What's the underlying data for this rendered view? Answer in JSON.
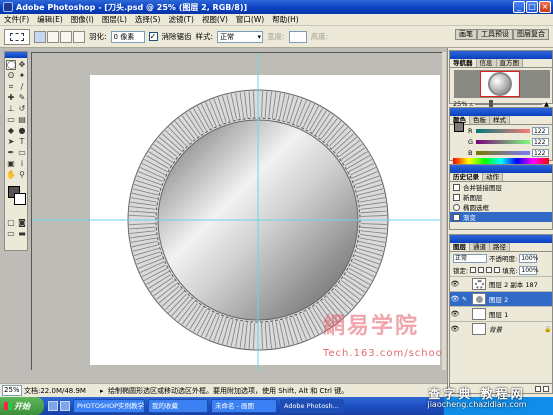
{
  "window": {
    "title": "Adobe Photoshop - [刀头.psd @ 25% (图层 2, RGB/8)]",
    "controls": {
      "minimize": "_",
      "maximize": "□",
      "close": "×"
    }
  },
  "menu": [
    "文件(F)",
    "编辑(E)",
    "图像(I)",
    "图层(L)",
    "选择(S)",
    "滤镜(T)",
    "视图(V)",
    "窗口(W)",
    "帮助(H)"
  ],
  "options": {
    "feather_label": "羽化:",
    "feather_value": "0 像素",
    "antialias_label": "消除锯齿",
    "antialias_checked": "✓",
    "style_label": "样式:",
    "style_value": "正常",
    "width_label": "宽度:",
    "height_label": "高度:"
  },
  "palette_well": [
    "画笔",
    "工具预设",
    "图层复合"
  ],
  "navigator": {
    "tabs": [
      "导航器",
      "信息",
      "直方图"
    ],
    "zoom": "25%"
  },
  "color_panel": {
    "tabs": [
      "颜色",
      "色板",
      "样式"
    ],
    "channels": [
      {
        "ch": "R",
        "value": "122"
      },
      {
        "ch": "G",
        "value": "122"
      },
      {
        "ch": "B",
        "value": "122"
      }
    ],
    "swatch_color": "#7a7a7a"
  },
  "history": {
    "tabs": [
      "历史记录",
      "动作"
    ],
    "items": [
      "合并链接图层",
      "新图层",
      "椭圆选框",
      "渐变"
    ],
    "selected_index": 3
  },
  "layers": {
    "tabs": [
      "图层",
      "通道",
      "路径"
    ],
    "blend_mode": "正常",
    "opacity_label": "不透明度:",
    "opacity_value": "100%",
    "lock_label": "锁定:",
    "fill_label": "填充:",
    "fill_value": "100%",
    "list": [
      "图层 2 副本 187",
      "图层 2",
      "图层 1",
      "背景"
    ],
    "selected_index": 1
  },
  "status": {
    "zoom": "25%",
    "doc_size": "文档:22.0M/48.9M",
    "hint": "绘制椭圆形选区或移动选区外框。要用附加选项，使用 Shift, Alt 和 Ctrl 键。"
  },
  "taskbar": {
    "start": "开始",
    "buttons": [
      "PHOTOSHOP实例教学",
      "我的收藏",
      "未命名 - 画图",
      "Adobe Photosh..."
    ]
  },
  "watermarks": {
    "netease_cn": "網易学院",
    "netease_url_main": "Tech.163.com/",
    "netease_url_tail": "school",
    "site_cn": "查字典 教程网",
    "site_url": "jiaocheng.chazidian.com"
  },
  "colors": {
    "title_blue": "#0a3fbf",
    "selection_blue": "#316ac5",
    "guide_cyan": "#6fd3e8",
    "panel_bg": "#ece9d8"
  }
}
